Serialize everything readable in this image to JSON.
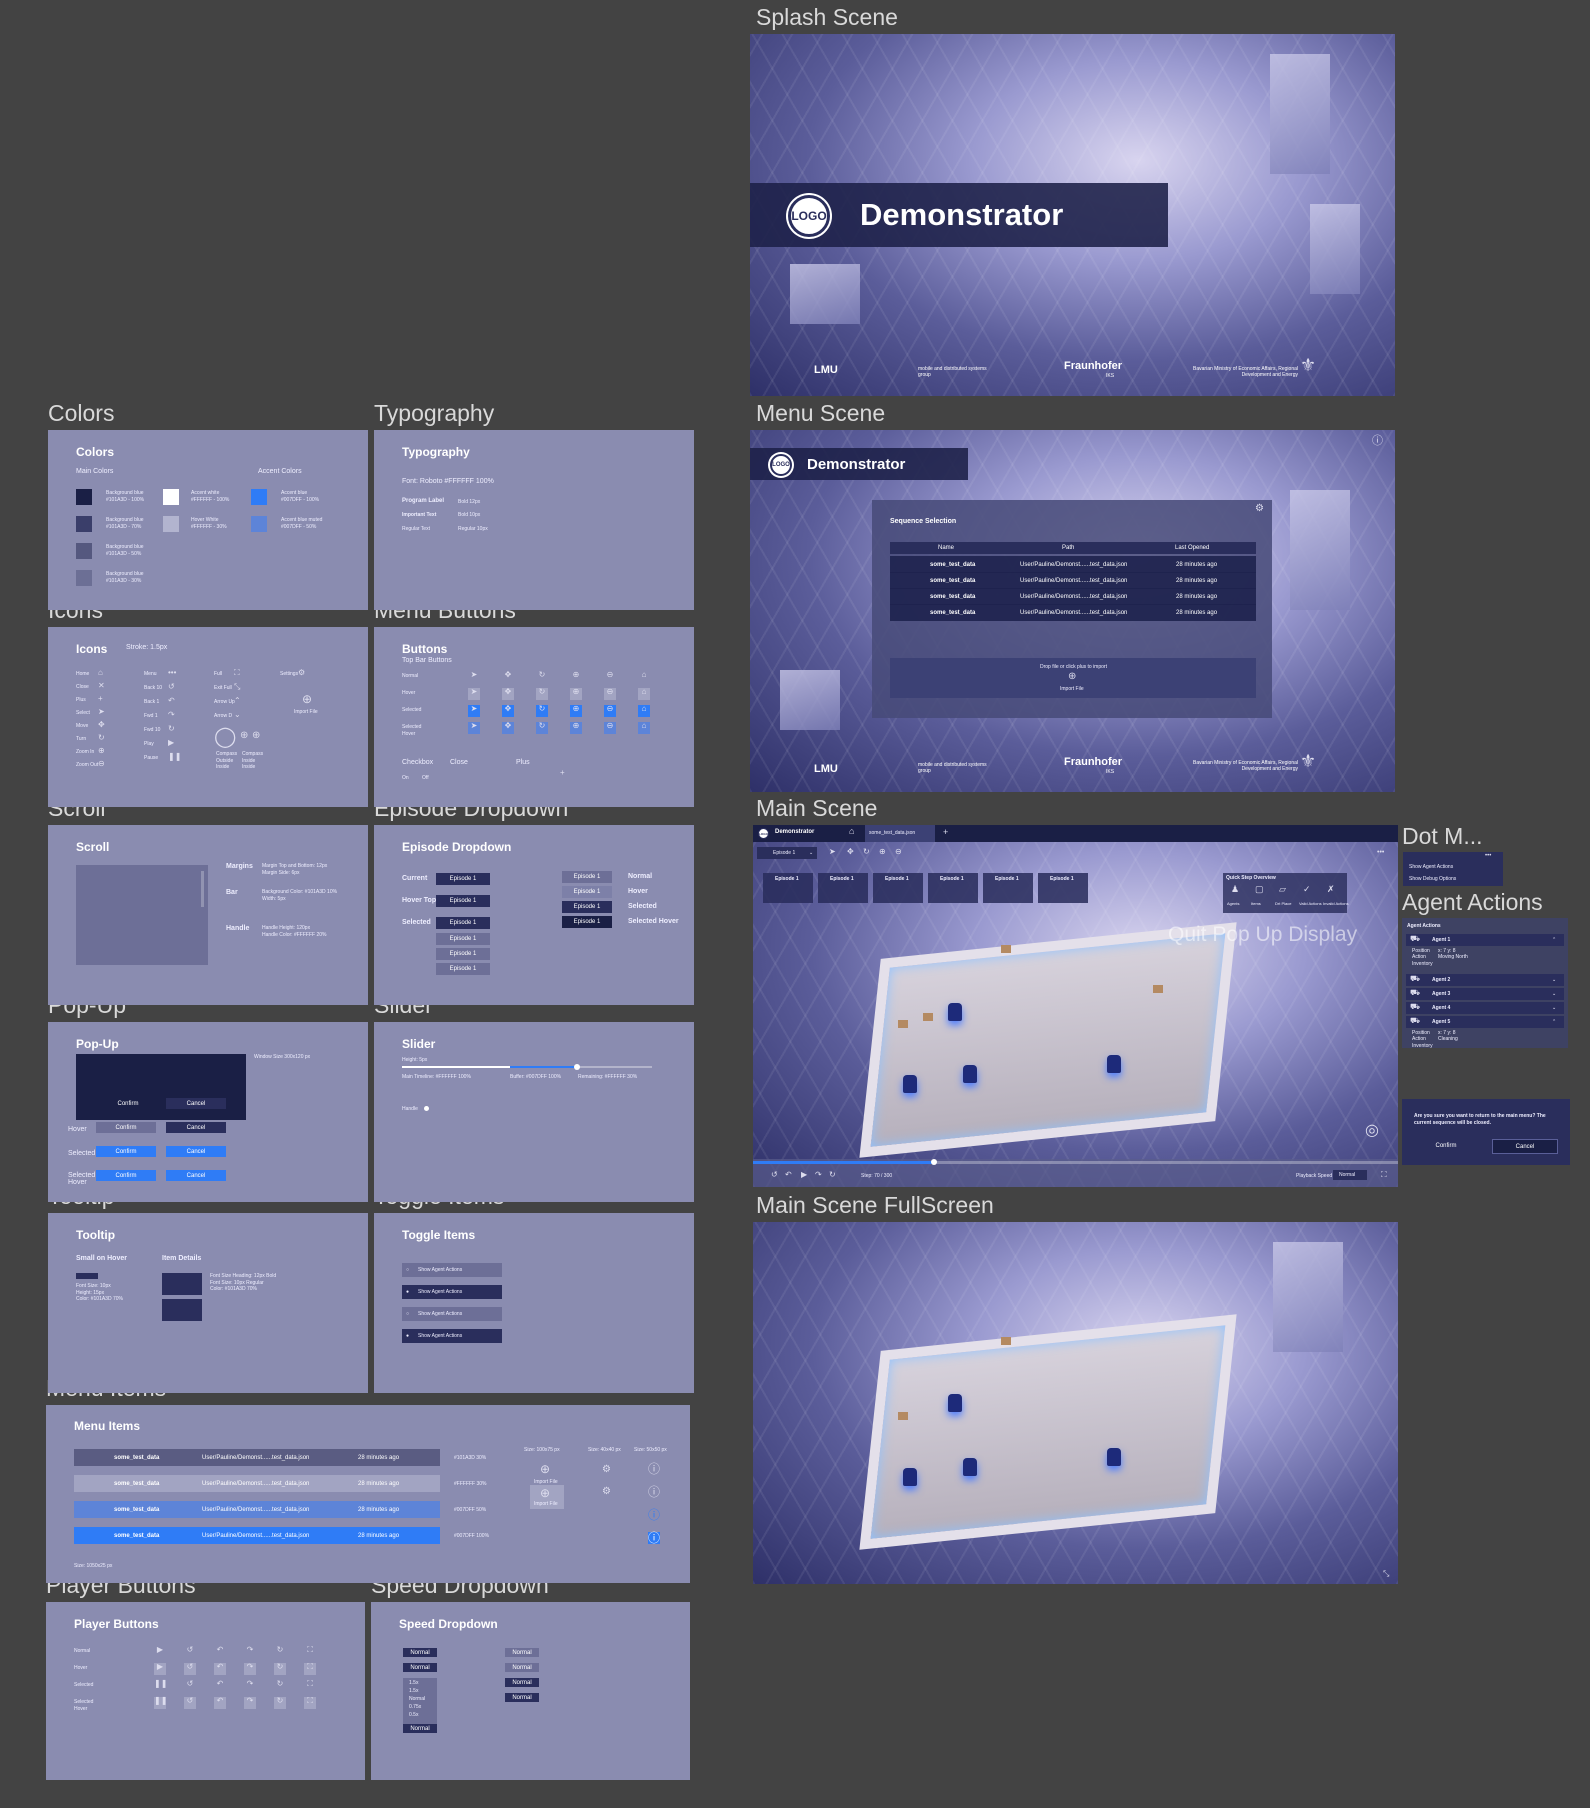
{
  "frames": {
    "splash": "Splash Scene",
    "menu": "Menu Scene",
    "main": "Main Scene",
    "dot": "Dot M...",
    "agent_actions": "Agent Actions",
    "quit_popup": "Quit Pop Up Display",
    "fullscreen": "Main Scene FullScreen",
    "colors": "Colors",
    "typography": "Typography",
    "icons": "Icons",
    "menu_buttons": "Menu Buttons",
    "scroll": "Scroll",
    "episode_dropdown": "Episode Dropdown",
    "popup": "Pop-Up",
    "slider": "Slider",
    "tooltip": "Tooltip",
    "toggle_items": "Toggle Items",
    "menu_items": "Menu Items",
    "player_buttons": "Player Buttons",
    "speed_dropdown": "Speed Dropdown"
  },
  "app": {
    "title": "Demonstrator",
    "logo": "LOGO"
  },
  "footer": {
    "lmu": "LMU",
    "mobile": "mobile and distributed systems group",
    "fraunhofer": "Fraunhofer",
    "iks": "IKS",
    "ministry": "Bavarian Ministry of Economic Affairs, Regional Development and Energy"
  },
  "menu_scene": {
    "sequence_title": "Sequence Selection",
    "columns": [
      "Name",
      "Path",
      "Last Opened"
    ],
    "rows": [
      {
        "name": "some_test_data",
        "path": "User/Pauline/Demonst......test_data.json",
        "opened": "28 minutes ago"
      },
      {
        "name": "some_test_data",
        "path": "User/Pauline/Demonst......test_data.json",
        "opened": "28 minutes ago"
      },
      {
        "name": "some_test_data",
        "path": "User/Pauline/Demonst......test_data.json",
        "opened": "28 minutes ago"
      },
      {
        "name": "some_test_data",
        "path": "User/Pauline/Demonst......test_data.json",
        "opened": "28 minutes ago"
      }
    ],
    "drop_hint": "Drop file or click plus to import",
    "import": "Import File"
  },
  "main_scene": {
    "tab": "some_test_data.json",
    "episode": "Episode 1",
    "episodes": [
      "Episode 1",
      "Episode 1",
      "Episode 1",
      "Episode 1",
      "Episode 1",
      "Episode 1"
    ],
    "quick_step": "Quick Step Overview",
    "quick_items": [
      "Agents",
      "Items",
      "Drt Place",
      "Valid Actions",
      "Invalid Actions"
    ],
    "step": "Step: 70 / 300",
    "playback": "Playback Speed",
    "speed": "Normal"
  },
  "dot_menu": {
    "items": [
      "Show Agent Actions",
      "Show Debug Options"
    ]
  },
  "agent_actions": {
    "title": "Agent Actions",
    "agents": [
      "Agent 1",
      "Agent 2",
      "Agent 3",
      "Agent 4",
      "Agent 5"
    ],
    "position": "Position",
    "action": "Action",
    "inventory": "Inventory",
    "pos1": "x: 7  y: 8",
    "act1": "Moving North",
    "pos5": "x: 7  y: 8",
    "act5": "Cleaning"
  },
  "quit": {
    "text": "Are you sure you want to return to the main menu? The current sequence will be closed.",
    "confirm": "Confirm",
    "cancel": "Cancel"
  },
  "colors": {
    "title": "Colors",
    "main": "Main Colors",
    "accent": "Accent Colors",
    "items": [
      {
        "label": "Background blue\n#101A3D - 100%",
        "color": "#1a1f45"
      },
      {
        "label": "Background blue\n#101A3D - 70%",
        "color": "#3a3e6a"
      },
      {
        "label": "Background blue\n#101A3D - 50%",
        "color": "#55587f"
      },
      {
        "label": "Background blue\n#101A3D - 30%",
        "color": "#6c6f95"
      }
    ],
    "white": {
      "label": "Accent white\n#FFFFFF - 100%",
      "color": "#ffffff"
    },
    "hover": {
      "label": "Hover White\n#FFFFFF - 30%",
      "color": "#b2b4cf"
    },
    "blue": {
      "label": "Accent blue\n#007DFF - 100%",
      "color": "#2f7cf6"
    },
    "blue_muted": {
      "label": "Accent blue muted\n#007DFF - 50%",
      "color": "#5d84d8"
    }
  },
  "typography": {
    "title": "Typography",
    "font": "Font: Roboto  #FFFFFF 100%",
    "program": "Program Label",
    "program_v": "Bold 12px",
    "important": "Important Text",
    "important_v": "Bold 10px",
    "regular": "Regular Text",
    "regular_v": "Regular 10px"
  },
  "icons": {
    "title": "Icons",
    "stroke": "Stroke: 1.5px",
    "names": [
      "Home",
      "Close",
      "Plus",
      "Select",
      "Move",
      "Turn",
      "Zoom In",
      "Zoom Out"
    ],
    "names2": [
      "Menu",
      "Back 10",
      "Back 1",
      "Fwd 1",
      "Fwd 10",
      "Play",
      "Pause"
    ],
    "names3": [
      "Full",
      "Exit Full",
      "Arrow Up",
      "Arrow D"
    ],
    "settings": "Settings",
    "import": "Import File",
    "compass": "Compass Outside Inside",
    "compass2": "Compass Inside Inside"
  },
  "buttons": {
    "title": "Buttons",
    "sub": "Top Bar Buttons",
    "states": [
      "Normal",
      "Hover",
      "Selected",
      "Selected Hover"
    ],
    "checkbox": "Checkbox",
    "close": "Close",
    "plus": "Plus",
    "on": "On",
    "off": "Off"
  },
  "scroll": {
    "title": "Scroll",
    "margins": "Margins",
    "margins_v": "Margin Top and Bottom: 12px\nMargin Side: 6px",
    "bar": "Bar",
    "bar_v": "Background Color: #101A3D 10%\nWidth: 5px",
    "handle": "Handle",
    "handle_v": "Handle Height: 120px\nHandle Color: #FFFFFF 20%"
  },
  "episode": {
    "title": "Episode Dropdown",
    "current": "Current",
    "hover": "Hover Top",
    "selected": "Selected",
    "ep": "Episode 1",
    "states": [
      "Normal",
      "Hover",
      "Selected",
      "Selected Hover"
    ]
  },
  "popup": {
    "title": "Pop-Up",
    "confirm": "Confirm",
    "cancel": "Cancel",
    "hover": "Hover",
    "selected": "Selected",
    "sel_hover": "Selected Hover",
    "note": "Window Size 300x120 px"
  },
  "slider": {
    "title": "Slider",
    "height": "Height: 5px",
    "main": "Main Timeline: #FFFFFF 100%",
    "buffer": "Buffer: #007DFF 100%",
    "remaining": "Remaining: #FFFFFF 30%",
    "handle": "Handle"
  },
  "tooltip": {
    "title": "Tooltip",
    "small": "Small on Hover",
    "details": "Item Details",
    "small_note": "Font Size: 10px\nHeight: 15px\nColor: #101A3D 70%",
    "details_note": "Font Size Heading: 12px Bold\nFont Size: 10px Regular\nColor: #101A3D 70%"
  },
  "toggle": {
    "title": "Toggle Items",
    "items": [
      "Show Agent Actions",
      "Show Agent Actions",
      "Show Agent Actions",
      "Show Agent Actions"
    ]
  },
  "menu_items": {
    "title": "Menu Items",
    "rows": [
      {
        "name": "some_test_data",
        "path": "User/Pauline/Demonst......test_data.json",
        "opened": "28 minutes ago",
        "note": "#101A3D 30%"
      },
      {
        "name": "some_test_data",
        "path": "User/Pauline/Demonst......test_data.json",
        "opened": "28 minutes ago",
        "note": "#FFFFFF 30%"
      },
      {
        "name": "some_test_data",
        "path": "User/Pauline/Demonst......test_data.json",
        "opened": "28 minutes ago",
        "note": "#007DFF 50%"
      },
      {
        "name": "some_test_data",
        "path": "User/Pauline/Demonst......test_data.json",
        "opened": "28 minutes ago",
        "note": "#007DFF 100%"
      }
    ],
    "size": "Size: 1050x25 px",
    "size2": "Size: 100x75 px",
    "size3": "Size: 40x40 px",
    "size4": "Size: 50x50 px",
    "import": "Import File"
  },
  "player": {
    "title": "Player Buttons",
    "states": [
      "Normal",
      "Hover",
      "Selected",
      "Selected Hover"
    ]
  },
  "speed": {
    "title": "Speed Dropdown",
    "normal": "Normal",
    "options": [
      "1.5x",
      "1.5x",
      "Normal",
      "0.75x",
      "0.5x"
    ]
  },
  "palette": {
    "panel": "#8a8cb0",
    "dark": "#1a1f45",
    "accent": "#2f7cf6",
    "bg": "#434343"
  }
}
